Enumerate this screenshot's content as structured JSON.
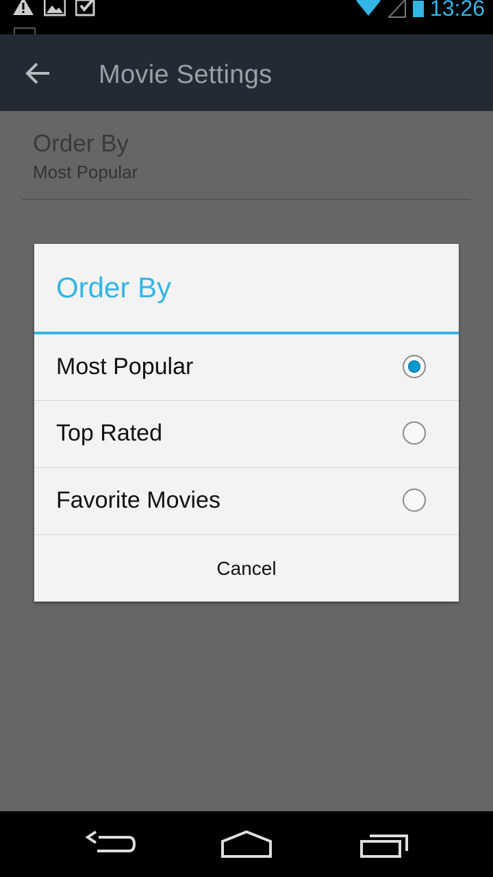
{
  "status_bar": {
    "time": "13:26",
    "icons": [
      "warning-icon",
      "image-icon",
      "clipboard-check-icon",
      "wifi-icon",
      "signal-icon",
      "battery-icon"
    ]
  },
  "action_bar": {
    "title": "Movie Settings",
    "back_icon": "arrow-back-icon"
  },
  "preference": {
    "title": "Order By",
    "summary": "Most Popular"
  },
  "dialog": {
    "title": "Order By",
    "options": [
      {
        "label": "Most Popular",
        "checked": true
      },
      {
        "label": "Top Rated",
        "checked": false
      },
      {
        "label": "Favorite Movies",
        "checked": false
      }
    ],
    "cancel_label": "Cancel"
  },
  "nav_bar": {
    "icons": [
      "back-icon",
      "home-icon",
      "recents-icon"
    ]
  },
  "colors": {
    "accent": "#33b5e5",
    "radio_fill": "#0099cc",
    "action_bar": "#222a33",
    "scrim": "#666666"
  }
}
